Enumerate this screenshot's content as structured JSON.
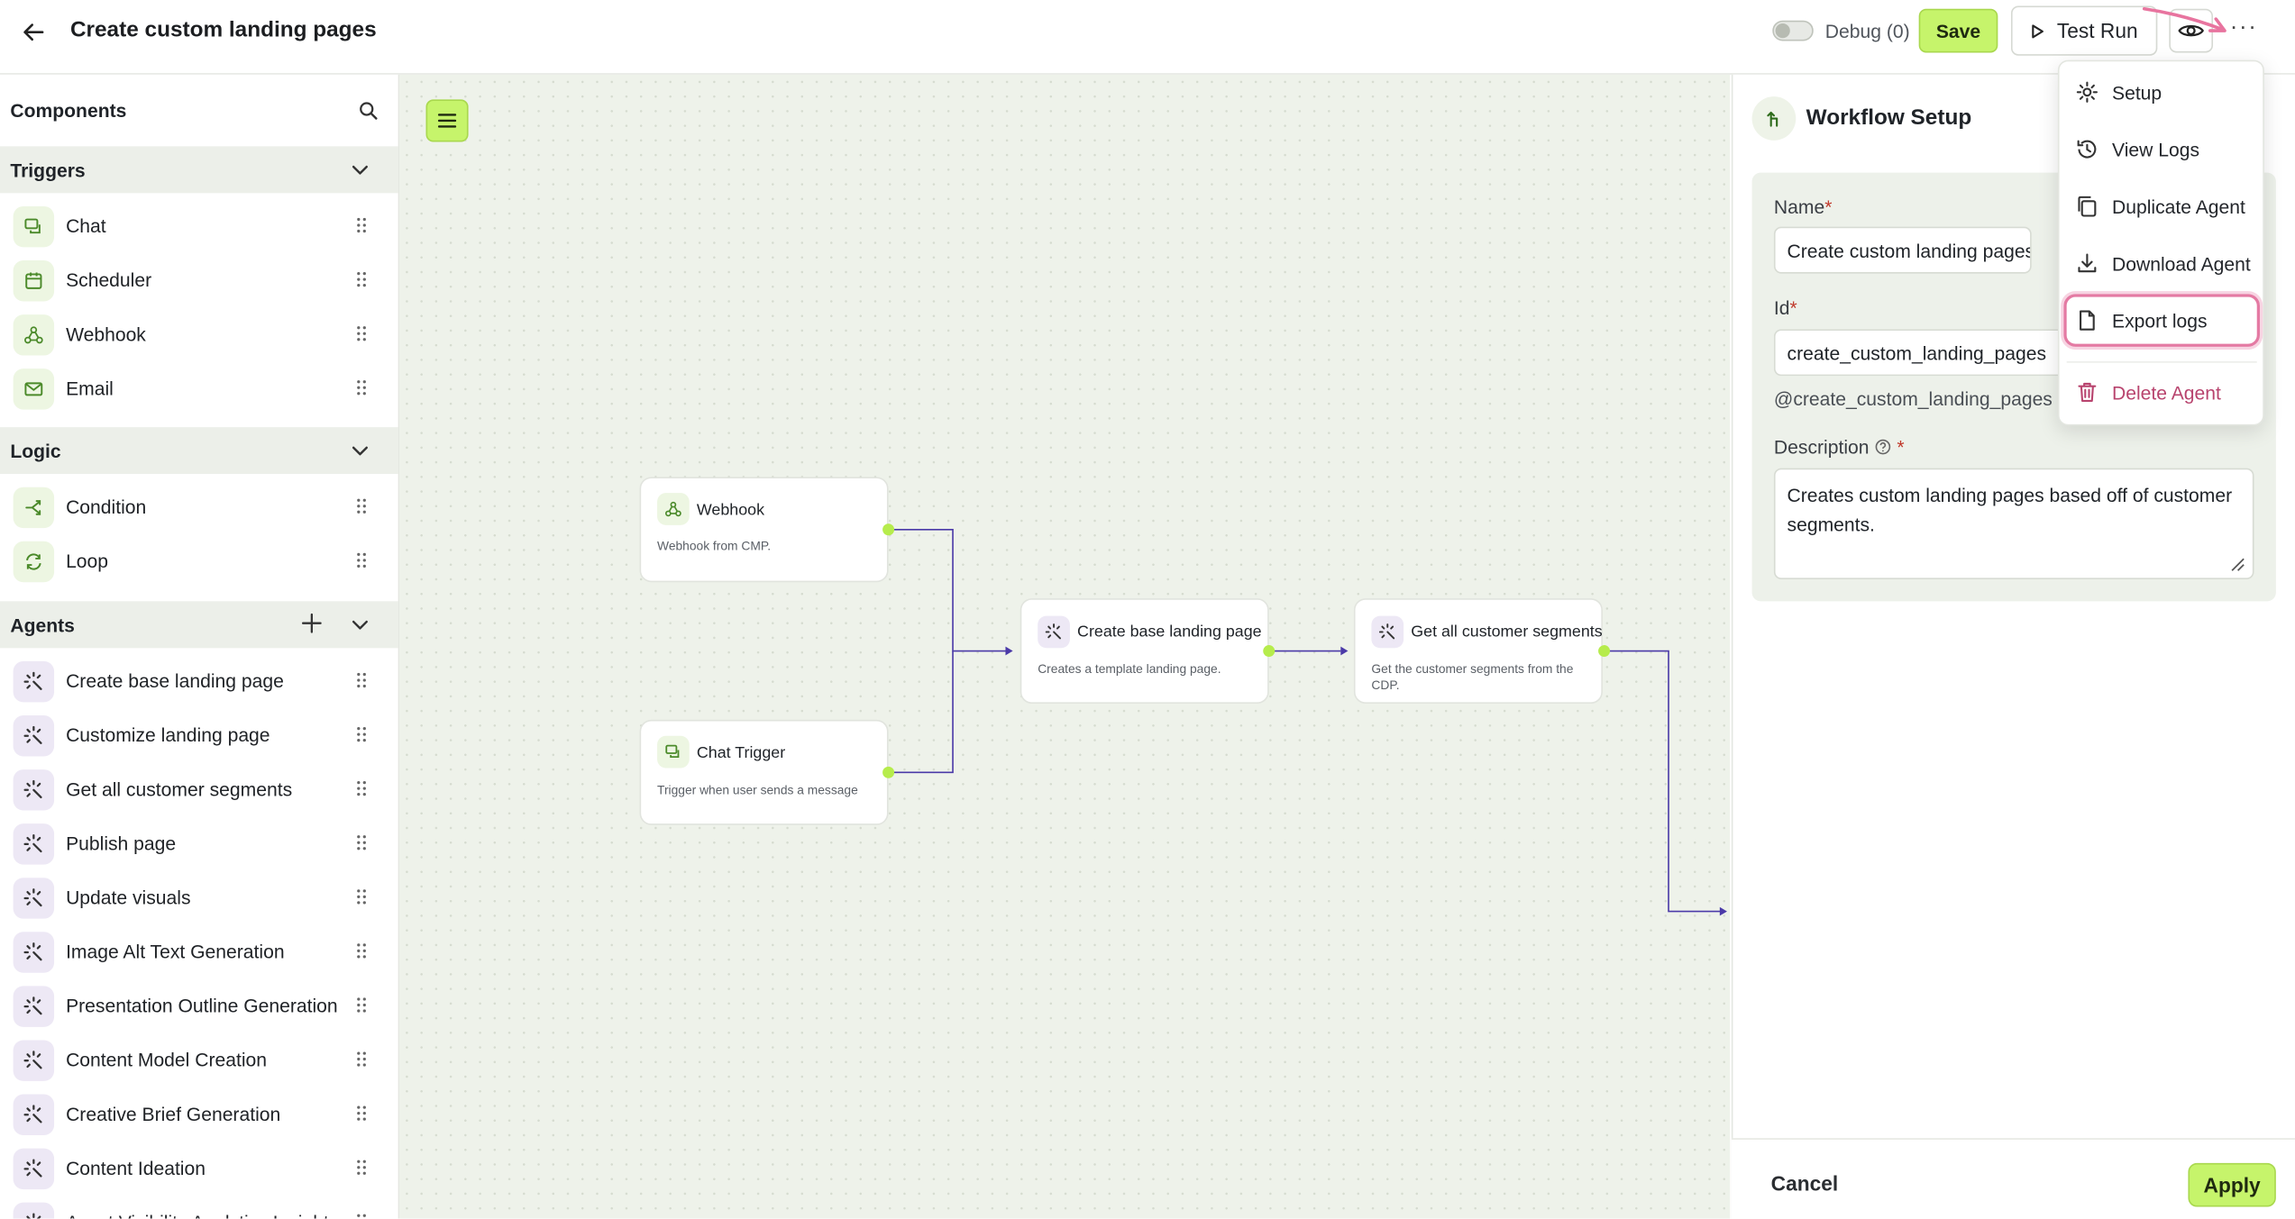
{
  "header": {
    "title": "Create custom landing pages",
    "debug_label": "Debug (0)",
    "save_label": "Save",
    "test_run_label": "Test Run",
    "more_label": "···"
  },
  "sidebar": {
    "title": "Components",
    "sections": {
      "triggers": {
        "title": "Triggers",
        "items": [
          {
            "label": "Chat",
            "icon": "chat-icon"
          },
          {
            "label": "Scheduler",
            "icon": "calendar-icon"
          },
          {
            "label": "Webhook",
            "icon": "webhook-icon"
          },
          {
            "label": "Email",
            "icon": "mail-icon"
          }
        ]
      },
      "logic": {
        "title": "Logic",
        "items": [
          {
            "label": "Condition",
            "icon": "branch-icon"
          },
          {
            "label": "Loop",
            "icon": "loop-icon"
          }
        ]
      },
      "agents": {
        "title": "Agents",
        "items": [
          {
            "label": "Create base landing page",
            "icon": "agent-icon"
          },
          {
            "label": "Customize landing page",
            "icon": "agent-icon"
          },
          {
            "label": "Get all customer segments",
            "icon": "agent-icon"
          },
          {
            "label": "Publish page",
            "icon": "agent-icon"
          },
          {
            "label": "Update visuals",
            "icon": "agent-icon"
          },
          {
            "label": "Image Alt Text Generation",
            "icon": "agent-icon"
          },
          {
            "label": "Presentation Outline Generation",
            "icon": "agent-icon"
          },
          {
            "label": "Content Model Creation",
            "icon": "agent-icon"
          },
          {
            "label": "Creative Brief Generation",
            "icon": "agent-icon"
          },
          {
            "label": "Content Ideation",
            "icon": "agent-icon"
          },
          {
            "label": "Asset Visibility Analytics Insights",
            "icon": "agent-icon"
          }
        ]
      }
    }
  },
  "canvas": {
    "nodes": [
      {
        "id": "webhook",
        "title": "Webhook",
        "desc": "Webhook from CMP."
      },
      {
        "id": "chat_trigger",
        "title": "Chat Trigger",
        "desc": "Trigger when user sends a message"
      },
      {
        "id": "create_base",
        "title": "Create base landing page",
        "desc": "Creates a template landing page."
      },
      {
        "id": "segments",
        "title": "Get all customer segments",
        "desc": "Get the customer segments from the CDP."
      }
    ]
  },
  "panel": {
    "title": "Workflow Setup",
    "name_label": "Name",
    "name_value": "Create custom landing pages",
    "id_label": "Id",
    "id_value": "create_custom_landing_pages",
    "handle": "@create_custom_landing_pages",
    "description_label": "Description",
    "description_value": "Creates custom landing pages based off of customer segments.",
    "required_mark": "*",
    "cancel_label": "Cancel",
    "apply_label": "Apply"
  },
  "menu": {
    "items": [
      {
        "label": "Setup",
        "icon": "gear-icon"
      },
      {
        "label": "View Logs",
        "icon": "history-icon"
      },
      {
        "label": "Duplicate Agent",
        "icon": "copy-icon"
      },
      {
        "label": "Download Agent",
        "icon": "download-icon"
      },
      {
        "label": "Export logs",
        "icon": "file-icon",
        "highlighted": true
      },
      {
        "label": "Delete Agent",
        "icon": "trash-icon",
        "danger": true
      }
    ]
  },
  "colors": {
    "accent": "#c6f46b",
    "edge": "#4b3aa8",
    "highlight": "#e47aa3",
    "danger": "#b8446e"
  }
}
